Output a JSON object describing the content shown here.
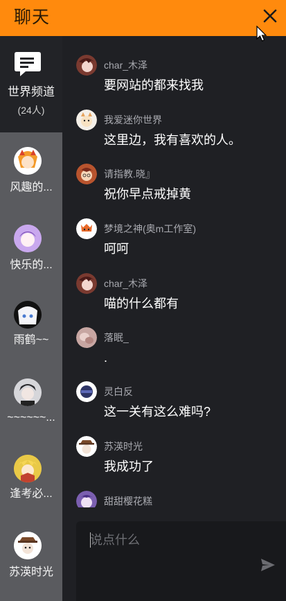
{
  "header": {
    "title": "聊天"
  },
  "icons": {
    "close": "close-icon",
    "cursor": "mouse-pointer-icon",
    "world": "chat-bubble-icon",
    "send": "send-icon"
  },
  "colors": {
    "accent": "#ff8a0d",
    "sidebar": "#5a5b5f",
    "background": "#1f2024"
  },
  "sidebar": {
    "world": {
      "label": "世界频道",
      "count": "(24人)"
    },
    "contacts": [
      {
        "name": "风趣的..."
      },
      {
        "name": "快乐的..."
      },
      {
        "name": "雨鹤~~"
      },
      {
        "name": "~~~~~~..."
      },
      {
        "name": "逢考必..."
      },
      {
        "name": "苏渶时光"
      }
    ]
  },
  "messages": [
    {
      "name": "char_木泽",
      "text": "要网站的都来找我"
    },
    {
      "name": "我爱迷你世界",
      "text": "这里边，我有喜欢的人。"
    },
    {
      "name": "请指教.晓』",
      "text": "祝你早点戒掉黄"
    },
    {
      "name": "梦境之神(奥m工作室)",
      "text": "呵呵"
    },
    {
      "name": "char_木泽",
      "text": "喵的什么都有"
    },
    {
      "name": "落眠_",
      "text": "."
    },
    {
      "name": "灵白反",
      "text": "这一关有这么难吗?"
    },
    {
      "name": "苏渶时光",
      "text": "我成功了"
    },
    {
      "name": "甜甜樱花糕",
      "text": ""
    }
  ],
  "input": {
    "placeholder": "说点什么"
  }
}
